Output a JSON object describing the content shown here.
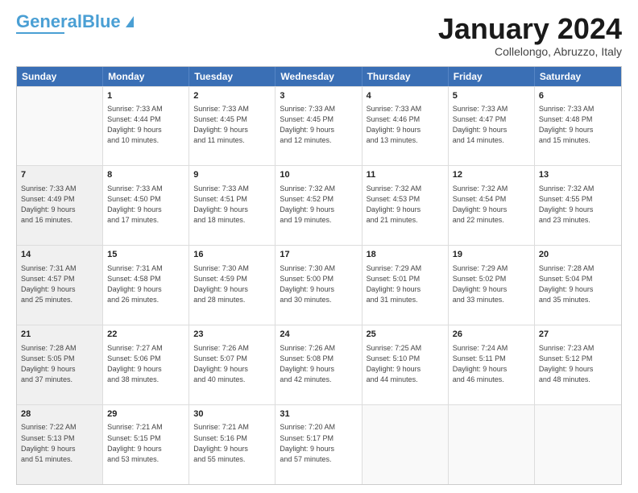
{
  "logo": {
    "line1": "General",
    "line2": "Blue"
  },
  "header": {
    "title": "January 2024",
    "location": "Collelongo, Abruzzo, Italy"
  },
  "weekdays": [
    "Sunday",
    "Monday",
    "Tuesday",
    "Wednesday",
    "Thursday",
    "Friday",
    "Saturday"
  ],
  "weeks": [
    [
      {
        "day": "",
        "info": "",
        "empty": true
      },
      {
        "day": "1",
        "info": "Sunrise: 7:33 AM\nSunset: 4:44 PM\nDaylight: 9 hours\nand 10 minutes."
      },
      {
        "day": "2",
        "info": "Sunrise: 7:33 AM\nSunset: 4:45 PM\nDaylight: 9 hours\nand 11 minutes."
      },
      {
        "day": "3",
        "info": "Sunrise: 7:33 AM\nSunset: 4:45 PM\nDaylight: 9 hours\nand 12 minutes."
      },
      {
        "day": "4",
        "info": "Sunrise: 7:33 AM\nSunset: 4:46 PM\nDaylight: 9 hours\nand 13 minutes."
      },
      {
        "day": "5",
        "info": "Sunrise: 7:33 AM\nSunset: 4:47 PM\nDaylight: 9 hours\nand 14 minutes."
      },
      {
        "day": "6",
        "info": "Sunrise: 7:33 AM\nSunset: 4:48 PM\nDaylight: 9 hours\nand 15 minutes."
      }
    ],
    [
      {
        "day": "7",
        "info": "Sunrise: 7:33 AM\nSunset: 4:49 PM\nDaylight: 9 hours\nand 16 minutes.",
        "shaded": true
      },
      {
        "day": "8",
        "info": "Sunrise: 7:33 AM\nSunset: 4:50 PM\nDaylight: 9 hours\nand 17 minutes."
      },
      {
        "day": "9",
        "info": "Sunrise: 7:33 AM\nSunset: 4:51 PM\nDaylight: 9 hours\nand 18 minutes."
      },
      {
        "day": "10",
        "info": "Sunrise: 7:32 AM\nSunset: 4:52 PM\nDaylight: 9 hours\nand 19 minutes."
      },
      {
        "day": "11",
        "info": "Sunrise: 7:32 AM\nSunset: 4:53 PM\nDaylight: 9 hours\nand 21 minutes."
      },
      {
        "day": "12",
        "info": "Sunrise: 7:32 AM\nSunset: 4:54 PM\nDaylight: 9 hours\nand 22 minutes."
      },
      {
        "day": "13",
        "info": "Sunrise: 7:32 AM\nSunset: 4:55 PM\nDaylight: 9 hours\nand 23 minutes."
      }
    ],
    [
      {
        "day": "14",
        "info": "Sunrise: 7:31 AM\nSunset: 4:57 PM\nDaylight: 9 hours\nand 25 minutes.",
        "shaded": true
      },
      {
        "day": "15",
        "info": "Sunrise: 7:31 AM\nSunset: 4:58 PM\nDaylight: 9 hours\nand 26 minutes."
      },
      {
        "day": "16",
        "info": "Sunrise: 7:30 AM\nSunset: 4:59 PM\nDaylight: 9 hours\nand 28 minutes."
      },
      {
        "day": "17",
        "info": "Sunrise: 7:30 AM\nSunset: 5:00 PM\nDaylight: 9 hours\nand 30 minutes."
      },
      {
        "day": "18",
        "info": "Sunrise: 7:29 AM\nSunset: 5:01 PM\nDaylight: 9 hours\nand 31 minutes."
      },
      {
        "day": "19",
        "info": "Sunrise: 7:29 AM\nSunset: 5:02 PM\nDaylight: 9 hours\nand 33 minutes."
      },
      {
        "day": "20",
        "info": "Sunrise: 7:28 AM\nSunset: 5:04 PM\nDaylight: 9 hours\nand 35 minutes."
      }
    ],
    [
      {
        "day": "21",
        "info": "Sunrise: 7:28 AM\nSunset: 5:05 PM\nDaylight: 9 hours\nand 37 minutes.",
        "shaded": true
      },
      {
        "day": "22",
        "info": "Sunrise: 7:27 AM\nSunset: 5:06 PM\nDaylight: 9 hours\nand 38 minutes."
      },
      {
        "day": "23",
        "info": "Sunrise: 7:26 AM\nSunset: 5:07 PM\nDaylight: 9 hours\nand 40 minutes."
      },
      {
        "day": "24",
        "info": "Sunrise: 7:26 AM\nSunset: 5:08 PM\nDaylight: 9 hours\nand 42 minutes."
      },
      {
        "day": "25",
        "info": "Sunrise: 7:25 AM\nSunset: 5:10 PM\nDaylight: 9 hours\nand 44 minutes."
      },
      {
        "day": "26",
        "info": "Sunrise: 7:24 AM\nSunset: 5:11 PM\nDaylight: 9 hours\nand 46 minutes."
      },
      {
        "day": "27",
        "info": "Sunrise: 7:23 AM\nSunset: 5:12 PM\nDaylight: 9 hours\nand 48 minutes."
      }
    ],
    [
      {
        "day": "28",
        "info": "Sunrise: 7:22 AM\nSunset: 5:13 PM\nDaylight: 9 hours\nand 51 minutes.",
        "shaded": true
      },
      {
        "day": "29",
        "info": "Sunrise: 7:21 AM\nSunset: 5:15 PM\nDaylight: 9 hours\nand 53 minutes."
      },
      {
        "day": "30",
        "info": "Sunrise: 7:21 AM\nSunset: 5:16 PM\nDaylight: 9 hours\nand 55 minutes."
      },
      {
        "day": "31",
        "info": "Sunrise: 7:20 AM\nSunset: 5:17 PM\nDaylight: 9 hours\nand 57 minutes."
      },
      {
        "day": "",
        "info": "",
        "empty": true
      },
      {
        "day": "",
        "info": "",
        "empty": true
      },
      {
        "day": "",
        "info": "",
        "empty": true
      }
    ]
  ]
}
